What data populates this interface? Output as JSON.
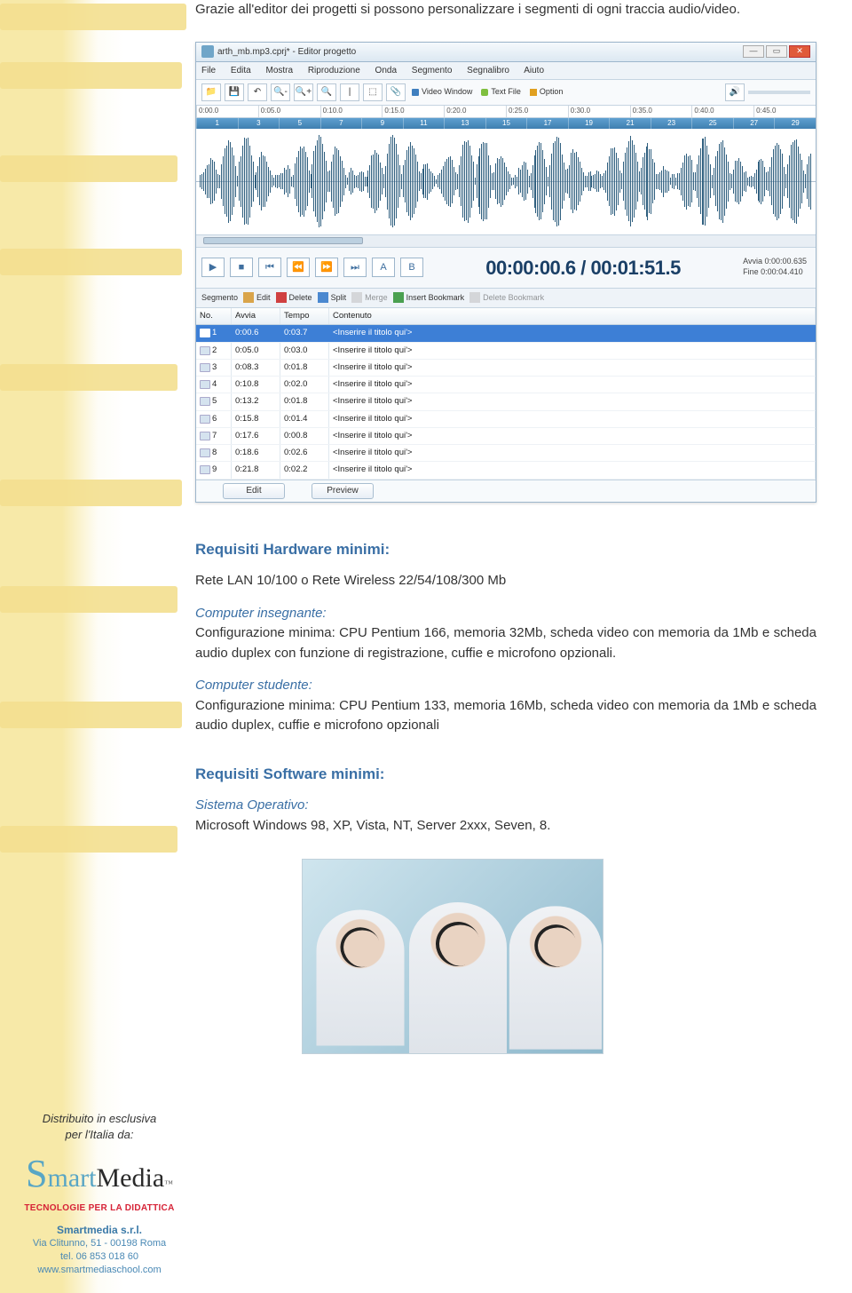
{
  "intro": "Grazie all'editor dei progetti si possono personalizzare i segmenti di ogni traccia audio/video.",
  "editor": {
    "title": "arth_mb.mp3.cprj* - Editor progetto",
    "menus": [
      "File",
      "Edita",
      "Mostra",
      "Riproduzione",
      "Onda",
      "Segmento",
      "Segnalibro",
      "Aiuto"
    ],
    "toolbarIcons": [
      "📁",
      "💾",
      "↶",
      "🔍-",
      "🔍+",
      "🔍",
      "|",
      "⬚",
      "📎"
    ],
    "toolbarLabels": {
      "videoWindow": "Video Window",
      "textFile": "Text File",
      "option": "Option"
    },
    "ruler": [
      "0:00.0",
      "0:05.0",
      "0:10.0",
      "0:15.0",
      "0:20.0",
      "0:25.0",
      "0:30.0",
      "0:35.0",
      "0:40.0",
      "0:45.0"
    ],
    "ruler2": [
      "1",
      "3",
      "5",
      "7",
      "9",
      "11",
      "13",
      "15",
      "17",
      "19",
      "21",
      "23",
      "25",
      "27",
      "29"
    ],
    "transportIcons": [
      "▶",
      "■",
      "⏮",
      "⏪",
      "⏩",
      "⏭",
      "A",
      "B"
    ],
    "timeDisplay": "00:00:00.6 / 00:01:51.5",
    "timeInfo": {
      "line1": "Avvia  0:00:00.635",
      "line2": "Fine  0:00:04.410"
    },
    "segbar": {
      "label": "Segmento",
      "edit": "Edit",
      "delete": "Delete",
      "split": "Split",
      "merge": "Merge",
      "insert": "Insert Bookmark",
      "deleteBm": "Delete Bookmark"
    },
    "columns": {
      "no": "No.",
      "avvia": "Avvia",
      "tempo": "Tempo",
      "contenuto": "Contenuto"
    },
    "rows": [
      {
        "no": "1",
        "avvia": "0:00.6",
        "tempo": "0:03.7",
        "cont": "<Inserire il titolo qui'>"
      },
      {
        "no": "2",
        "avvia": "0:05.0",
        "tempo": "0:03.0",
        "cont": "<Inserire il titolo qui'>"
      },
      {
        "no": "3",
        "avvia": "0:08.3",
        "tempo": "0:01.8",
        "cont": "<Inserire il titolo qui'>"
      },
      {
        "no": "4",
        "avvia": "0:10.8",
        "tempo": "0:02.0",
        "cont": "<Inserire il titolo qui'>"
      },
      {
        "no": "5",
        "avvia": "0:13.2",
        "tempo": "0:01.8",
        "cont": "<Inserire il titolo qui'>"
      },
      {
        "no": "6",
        "avvia": "0:15.8",
        "tempo": "0:01.4",
        "cont": "<Inserire il titolo qui'>"
      },
      {
        "no": "7",
        "avvia": "0:17.6",
        "tempo": "0:00.8",
        "cont": "<Inserire il titolo qui'>"
      },
      {
        "no": "8",
        "avvia": "0:18.6",
        "tempo": "0:02.6",
        "cont": "<Inserire il titolo qui'>"
      },
      {
        "no": "9",
        "avvia": "0:21.8",
        "tempo": "0:02.2",
        "cont": "<Inserire il titolo qui'>"
      }
    ],
    "bottomButtons": {
      "edit": "Edit",
      "preview": "Preview"
    }
  },
  "reqHardware": {
    "title": "Requisiti Hardware minimi:",
    "line1": "Rete LAN 10/100 o Rete Wireless 22/54/108/300 Mb",
    "teacherHead": "Computer insegnante:",
    "teacherBody": "Configurazione minima: CPU Pentium 166, memoria 32Mb, scheda video con memoria da 1Mb e scheda audio duplex con funzione di registrazione, cuffie e microfono opzionali.",
    "studentHead": "Computer studente:",
    "studentBody": "Configurazione minima: CPU Pentium 133, memoria 16Mb, scheda video con memoria da 1Mb e scheda audio duplex, cuffie e microfono opzionali"
  },
  "reqSoftware": {
    "title": "Requisiti Software minimi:",
    "osHead": "Sistema Operativo:",
    "osBody": "Microsoft Windows 98, XP, Vista, NT, Server 2xxx, Seven, 8."
  },
  "footer": {
    "dist1": "Distribuito in esclusiva",
    "dist2": "per l'Italia da:",
    "logo1": "S",
    "logo2": "mart",
    "logo3": "Media",
    "tm": "™",
    "red": "TECNOLOGIE PER LA DIDATTICA",
    "company": "Smartmedia s.r.l.",
    "addr": "Via Clitunno, 51 - 00198 Roma",
    "tel": "tel. 06 853 018 60",
    "web": "www.smartmediaschool.com"
  }
}
